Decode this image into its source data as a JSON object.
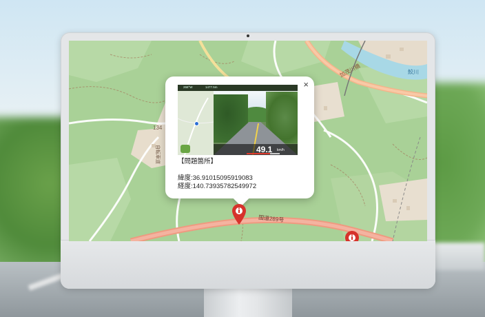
{
  "map": {
    "road_label_1": "国道289号",
    "road_label_2": "加茂川橋",
    "road_label_3": "鮫川",
    "road_label_4": "134",
    "road_label_5": "自転車道"
  },
  "popup": {
    "close": "×",
    "title": "【問題箇所】",
    "latitude": "緯度:36.91015095919083",
    "longitude": "経度:140.73935782549972"
  },
  "thumb": {
    "speed": "49.1",
    "unit": "km/h",
    "status_a": "268°W",
    "status_b": "1477.5m",
    "progress": 0.7
  },
  "colors": {
    "map_green": "#a9d197",
    "route": "#f2a57a",
    "pin": "#d6322b"
  }
}
